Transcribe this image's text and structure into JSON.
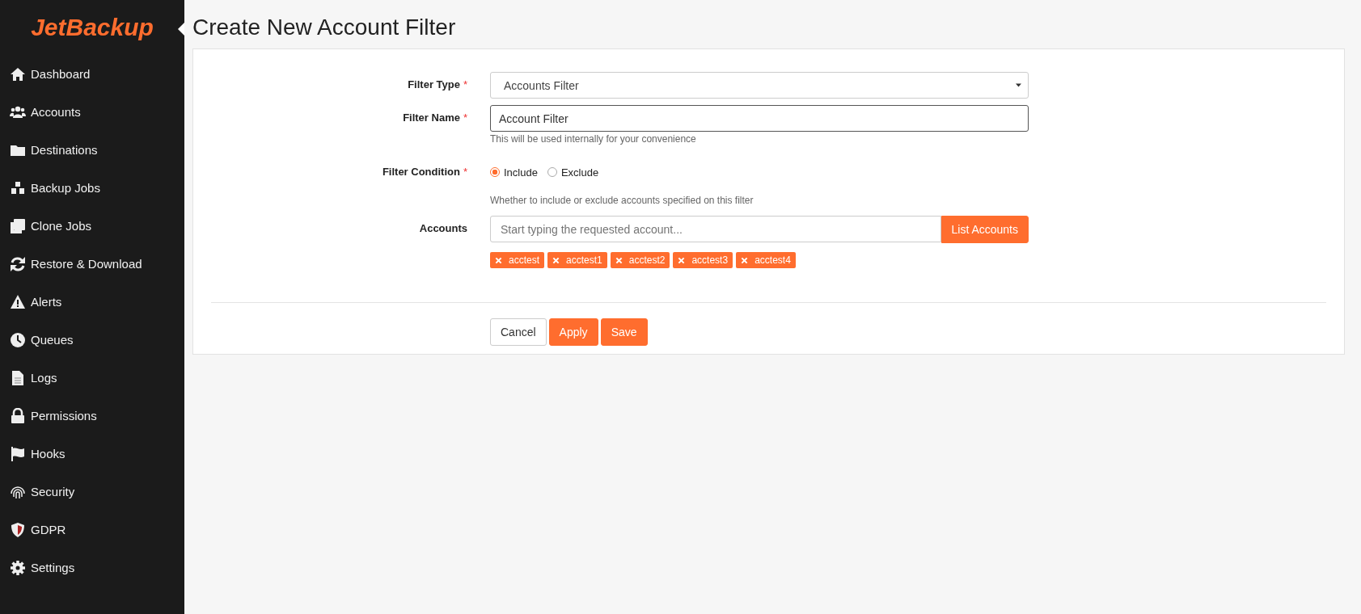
{
  "logo": "JetBackup",
  "sidebar": {
    "items": [
      {
        "label": "Dashboard",
        "selected": false
      },
      {
        "label": "Accounts",
        "selected": false
      },
      {
        "label": "Destinations",
        "selected": false
      },
      {
        "label": "Backup Jobs",
        "selected": false
      },
      {
        "label": "Clone Jobs",
        "selected": false
      },
      {
        "label": "Restore & Download",
        "selected": false
      },
      {
        "label": "Alerts",
        "selected": false
      },
      {
        "label": "Queues",
        "selected": false
      },
      {
        "label": "Logs",
        "selected": false
      },
      {
        "label": "Permissions",
        "selected": false
      },
      {
        "label": "Hooks",
        "selected": false
      },
      {
        "label": "Security",
        "selected": false
      },
      {
        "label": "GDPR",
        "selected": false
      },
      {
        "label": "Settings",
        "selected": false
      }
    ]
  },
  "page_title": "Create New Account Filter",
  "form": {
    "fields": [
      {
        "kind": "select",
        "label": "Filter Type",
        "required_mark": "*",
        "value": "Accounts Filter"
      },
      {
        "kind": "text",
        "label": "Filter Name",
        "required_mark": "*",
        "value": "Account Filter",
        "hint": "This will be used internally for your convenience"
      },
      {
        "kind": "radio",
        "label": "Filter Condition",
        "required_mark": "*",
        "options": [
          {
            "label": "Include",
            "selected": true
          },
          {
            "label": "Exclude",
            "selected": false
          }
        ],
        "hint": "Whether to include or exclude accounts specified on this filter"
      },
      {
        "kind": "tags",
        "label": "Accounts",
        "placeholder": "Start typing the requested account...",
        "button": "List Accounts",
        "tags": [
          "acctest",
          "acctest1",
          "acctest2",
          "acctest3",
          "acctest4"
        ]
      }
    ],
    "buttons": [
      {
        "label": "Cancel",
        "kind": "default"
      },
      {
        "label": "Apply",
        "kind": "primary"
      },
      {
        "label": "Save",
        "kind": "primary"
      }
    ]
  }
}
